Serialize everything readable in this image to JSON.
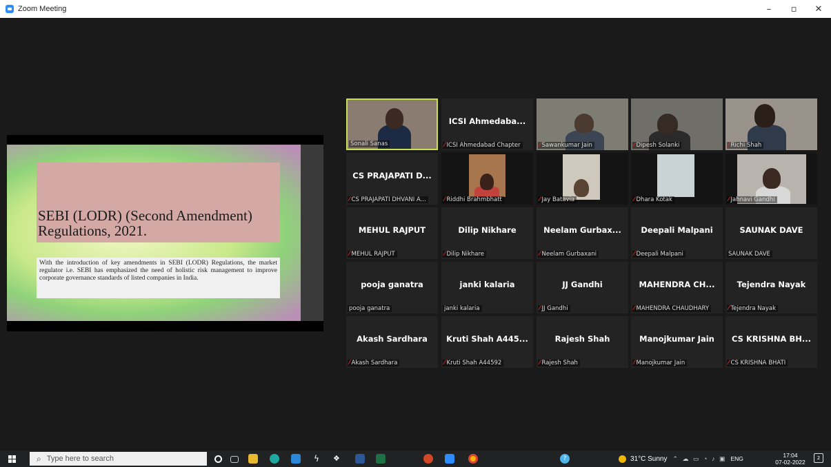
{
  "window": {
    "title": "Zoom Meeting",
    "controls": {
      "minimize": "–",
      "maximize": "▫",
      "close": "✕"
    }
  },
  "slide": {
    "title": "SEBI (LODR) (Second Amendment) Regulations, 2021.",
    "body": "With the introduction of key amendments in SEBI (LODR) Regulations, the market regulator i.e. SEBI has emphasized the need of holistic risk management to improve corporate governance standards of listed companies in India."
  },
  "participants": [
    {
      "display": "",
      "label": "Sonali Sanas",
      "muted": false,
      "video": true,
      "active": true
    },
    {
      "display": "ICSI Ahmedaba...",
      "label": "ICSI Ahmedabad Chapter",
      "muted": true,
      "video": false
    },
    {
      "display": "",
      "label": "Sawankumar Jain",
      "muted": true,
      "video": true
    },
    {
      "display": "",
      "label": "Dipesh Solanki",
      "muted": true,
      "video": true
    },
    {
      "display": "",
      "label": "Richi Shah",
      "muted": true,
      "video": true
    },
    {
      "display": "CS PRAJAPATI D...",
      "label": "CS PRAJAPATI DHVANI A...",
      "muted": true,
      "video": false
    },
    {
      "display": "",
      "label": "Riddhi Brahmbhatt",
      "muted": true,
      "video": true
    },
    {
      "display": "",
      "label": "Jay Batavia",
      "muted": true,
      "video": true
    },
    {
      "display": "",
      "label": "Dhara Kotak",
      "muted": true,
      "video": true
    },
    {
      "display": "",
      "label": "Jahnavi Gandhi",
      "muted": true,
      "video": true
    },
    {
      "display": "MEHUL RAJPUT",
      "label": "MEHUL RAJPUT",
      "muted": true,
      "video": false
    },
    {
      "display": "Dilip Nikhare",
      "label": "Dilip Nikhare",
      "muted": true,
      "video": false
    },
    {
      "display": "Neelam Gurbax...",
      "label": "Neelam Gurbaxani",
      "muted": true,
      "video": false
    },
    {
      "display": "Deepali Malpani",
      "label": "Deepali Malpani",
      "muted": true,
      "video": false
    },
    {
      "display": "SAUNAK DAVE",
      "label": "SAUNAK DAVE",
      "muted": false,
      "video": false
    },
    {
      "display": "pooja ganatra",
      "label": "pooja ganatra",
      "muted": false,
      "video": false
    },
    {
      "display": "janki kalaria",
      "label": "janki kalaria",
      "muted": false,
      "video": false
    },
    {
      "display": "JJ Gandhi",
      "label": "JJ Gandhi",
      "muted": true,
      "video": false
    },
    {
      "display": "MAHENDRA CH...",
      "label": "MAHENDRA CHAUDHARY",
      "muted": true,
      "video": false
    },
    {
      "display": "Tejendra Nayak",
      "label": "Tejendra Nayak",
      "muted": true,
      "video": false
    },
    {
      "display": "Akash Sardhara",
      "label": "Akash Sardhara",
      "muted": true,
      "video": false
    },
    {
      "display": "Kruti Shah A445...",
      "label": "Kruti Shah A44592",
      "muted": true,
      "video": false
    },
    {
      "display": "Rajesh Shah",
      "label": "Rajesh Shah",
      "muted": true,
      "video": false
    },
    {
      "display": "Manojkumar Jain",
      "label": "Manojkumar Jain",
      "muted": true,
      "video": false
    },
    {
      "display": "CS KRISHNA BH...",
      "label": "CS KRISHNA BHATI",
      "muted": true,
      "video": false
    }
  ],
  "taskbar": {
    "search_placeholder": "Type here to search",
    "weather": "31°C  Sunny",
    "language": "ENG",
    "time": "17:04",
    "date": "07-02-2022",
    "notifications": "2"
  },
  "colors": {
    "active_speaker": "#c8e04a",
    "mute": "#e02828",
    "zoom_blue": "#2d8cff"
  }
}
